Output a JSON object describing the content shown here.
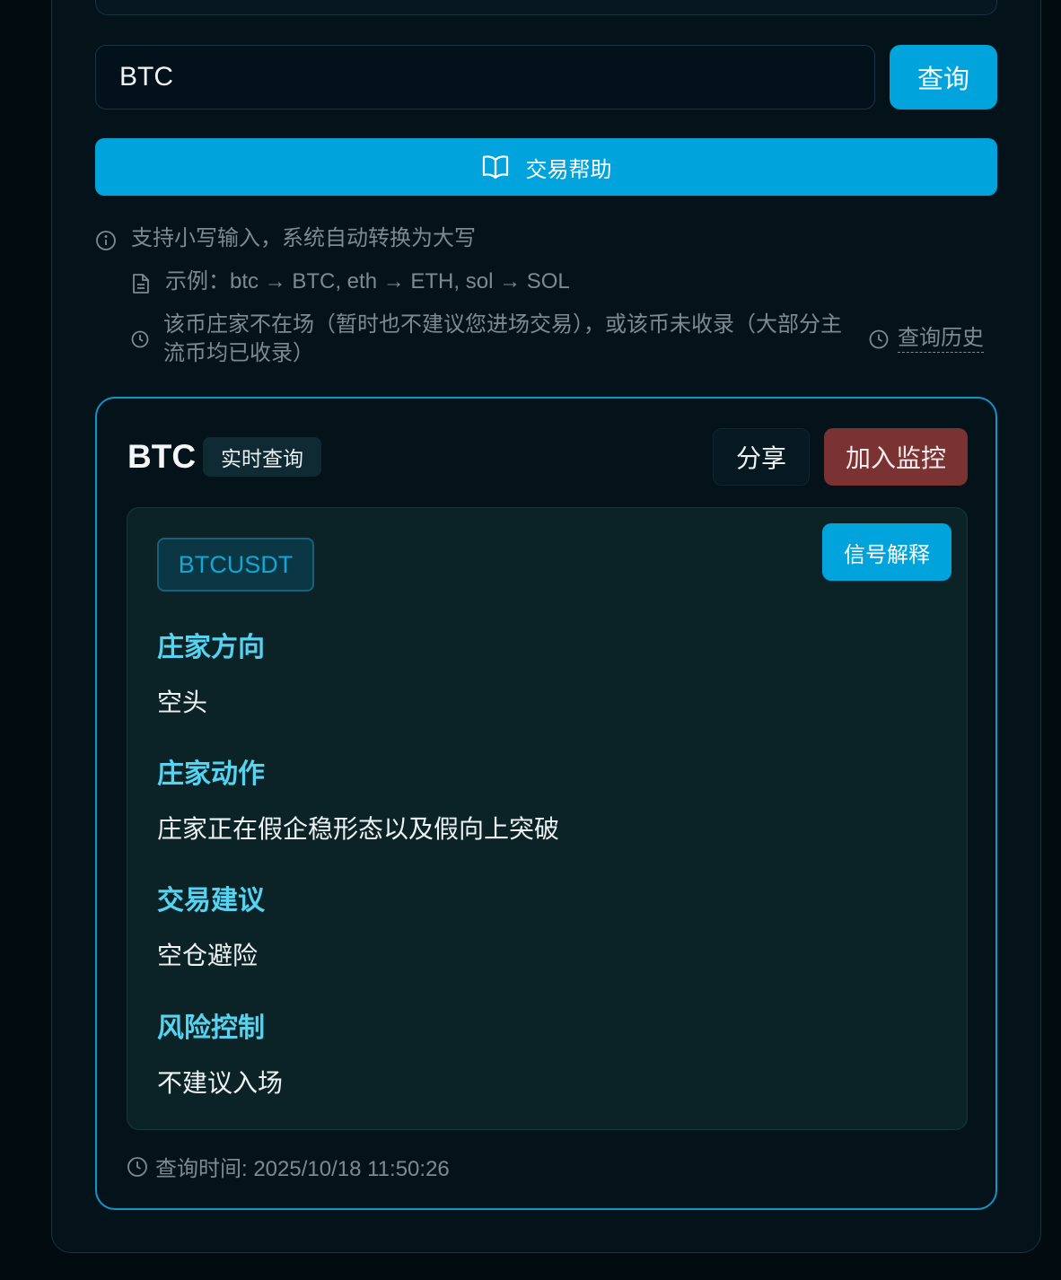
{
  "search": {
    "value": "BTC",
    "query_label": "查询"
  },
  "help_button": {
    "label": "交易帮助",
    "icon": "book-open-icon"
  },
  "hints": {
    "lowercase": "支持小写输入，系统自动转换为大写",
    "example": "示例：btc → BTC, eth → ETH, sol → SOL",
    "not_found": "该币庄家不在场（暂时也不建议您进场交易），或该币未收录（大部分主流币均已收录）",
    "history_link": "查询历史"
  },
  "result": {
    "coin": "BTC",
    "badge": "实时查询",
    "share_label": "分享",
    "monitor_label": "加入监控",
    "pair": "BTCUSDT",
    "explain_label": "信号解释",
    "sections": [
      {
        "label": "庄家方向",
        "value": "空头"
      },
      {
        "label": "庄家动作",
        "value": "庄家正在假企稳形态以及假向上突破"
      },
      {
        "label": "交易建议",
        "value": "空仓避险"
      },
      {
        "label": "风险控制",
        "value": "不建议入场"
      }
    ],
    "query_time": "查询时间: 2025/10/18 11:50:26"
  },
  "colors": {
    "accent": "#00a3dc",
    "monitor": "#7a3232",
    "section_label": "#55d4f2",
    "card_border": "#1493c6"
  }
}
